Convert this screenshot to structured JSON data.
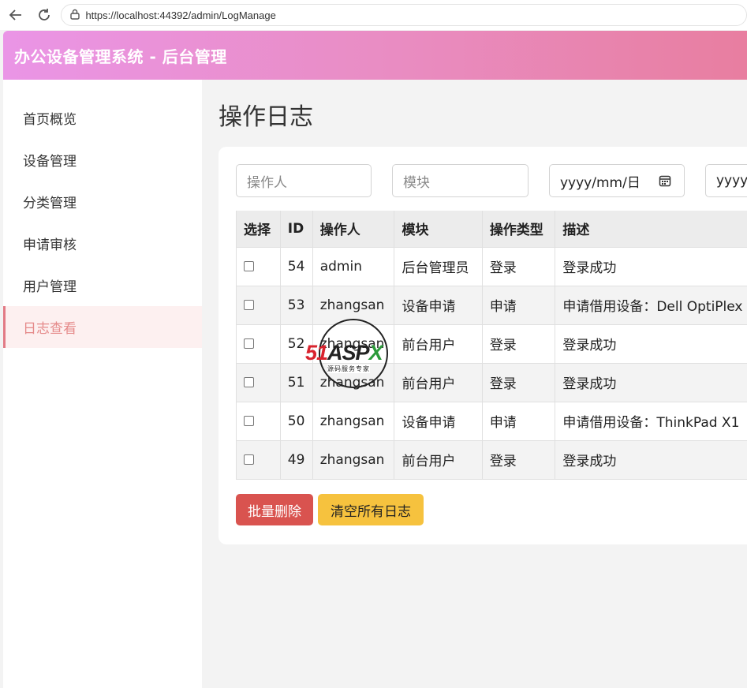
{
  "browser": {
    "url": "https://localhost:44392/admin/LogManage"
  },
  "app": {
    "title": "办公设备管理系统 - 后台管理"
  },
  "sidebar": {
    "items": [
      {
        "label": "首页概览"
      },
      {
        "label": "设备管理"
      },
      {
        "label": "分类管理"
      },
      {
        "label": "申请审核"
      },
      {
        "label": "用户管理"
      },
      {
        "label": "日志查看",
        "active": true
      }
    ]
  },
  "page": {
    "title": "操作日志"
  },
  "filters": {
    "operator_placeholder": "操作人",
    "module_placeholder": "模块",
    "start_date": "yyyy/mm/日",
    "end_date": "yyyy/"
  },
  "table": {
    "headers": [
      "选择",
      "ID",
      "操作人",
      "模块",
      "操作类型",
      "描述"
    ],
    "rows": [
      {
        "id": "54",
        "operator": "admin",
        "module": "后台管理员",
        "type": "登录",
        "desc": "登录成功"
      },
      {
        "id": "53",
        "operator": "zhangsan",
        "module": "设备申请",
        "type": "申请",
        "desc": "申请借用设备：Dell OptiPlex"
      },
      {
        "id": "52",
        "operator": "zhangsan",
        "module": "前台用户",
        "type": "登录",
        "desc": "登录成功"
      },
      {
        "id": "51",
        "operator": "zhangsan",
        "module": "前台用户",
        "type": "登录",
        "desc": "登录成功"
      },
      {
        "id": "50",
        "operator": "zhangsan",
        "module": "设备申请",
        "type": "申请",
        "desc": "申请借用设备：ThinkPad X1"
      },
      {
        "id": "49",
        "operator": "zhangsan",
        "module": "前台用户",
        "type": "登录",
        "desc": "登录成功"
      }
    ]
  },
  "actions": {
    "batch_delete": "批量删除",
    "clear_all": "清空所有日志"
  },
  "watermark": {
    "brand_51": "51",
    "brand_asp": "ASP",
    "brand_x": "X",
    "subtitle": "源码服务专家"
  },
  "colors": {
    "header_gradient_start": "#ea95e6",
    "header_gradient_end": "#e87ea0",
    "active_sidebar_text": "#e58a8a",
    "danger": "#d9534f",
    "warning": "#f6c23e"
  }
}
